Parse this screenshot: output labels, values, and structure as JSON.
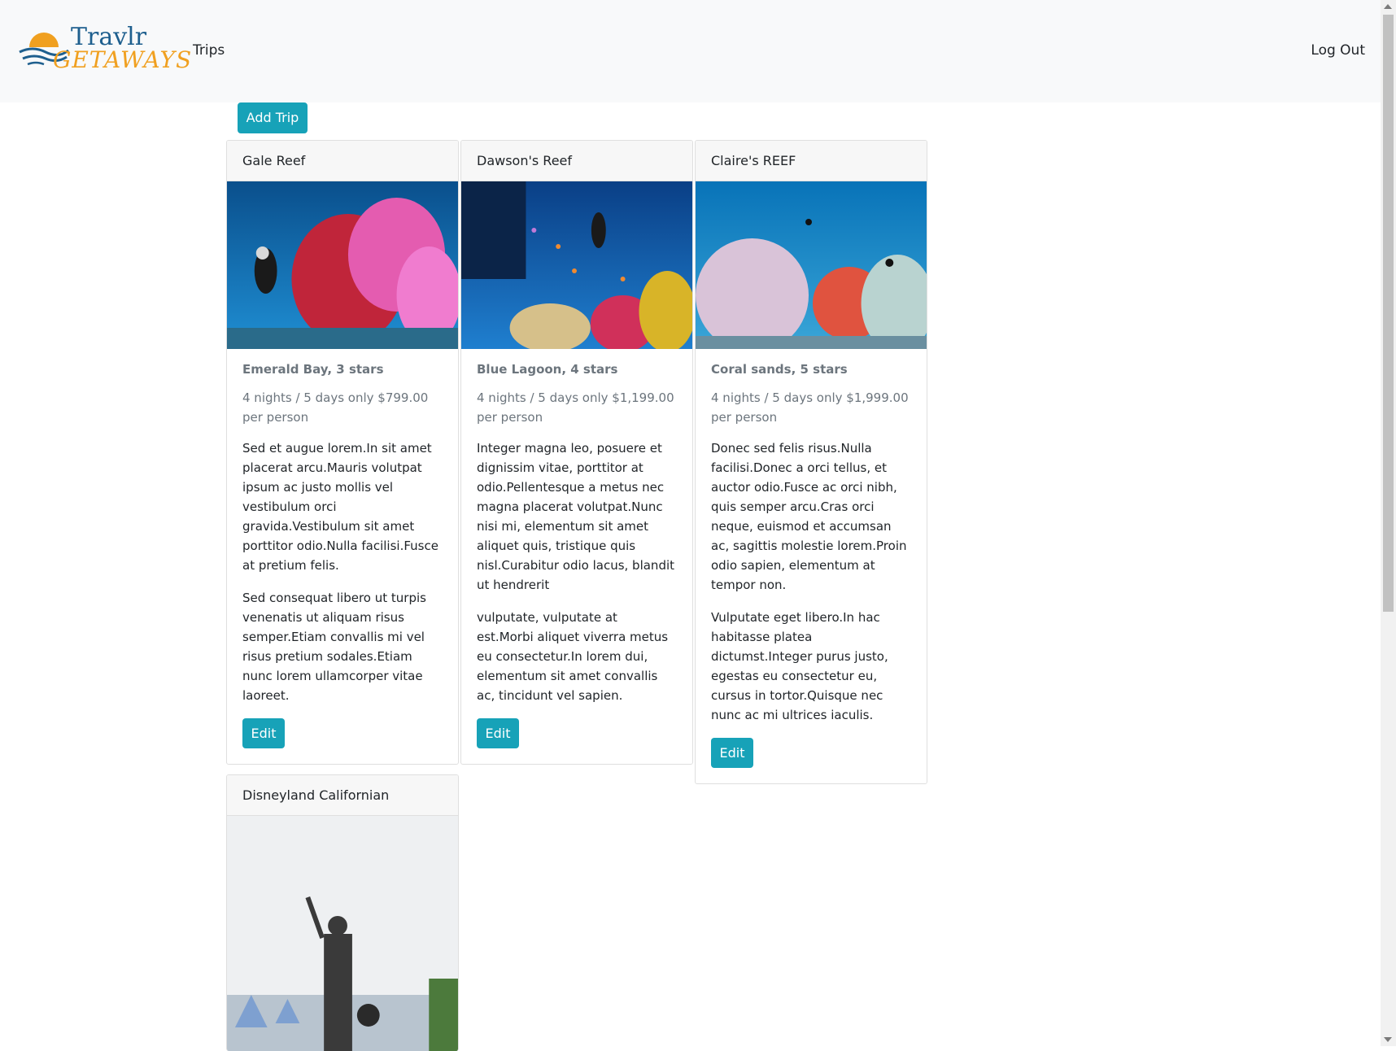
{
  "nav": {
    "logo_line1": "Travlr",
    "logo_line2": "GETAWAYS",
    "trips": "Trips",
    "logout": "Log Out"
  },
  "actions": {
    "add_trip": "Add Trip"
  },
  "cards": [
    {
      "title": "Gale Reef",
      "subtitle": "Emerald Bay, 3 stars",
      "price": "4 nights / 5 days only $799.00 per person",
      "p1": "Sed et augue lorem.In sit amet placerat arcu.Mauris volutpat ipsum ac justo mollis vel vestibulum orci gravida.Vestibulum sit amet porttitor odio.Nulla facilisi.Fusce at pretium felis.",
      "p2": "Sed consequat libero ut turpis venenatis ut aliquam risus semper.Etiam convallis mi vel risus pretium sodales.Etiam nunc lorem ullamcorper vitae laoreet.",
      "edit": "Edit"
    },
    {
      "title": "Dawson's Reef",
      "subtitle": "Blue Lagoon, 4 stars",
      "price": "4 nights / 5 days only $1,199.00 per person",
      "p1": "Integer magna leo, posuere et dignissim vitae, porttitor at odio.Pellentesque a metus nec magna placerat volutpat.Nunc nisi mi, elementum sit amet aliquet quis, tristique quis nisl.Curabitur odio lacus, blandit ut hendrerit",
      "p2": "vulputate, vulputate at est.Morbi aliquet viverra metus eu consectetur.In lorem dui, elementum sit amet convallis ac, tincidunt vel sapien.",
      "edit": "Edit"
    },
    {
      "title": "Claire's REEF",
      "subtitle": "Coral sands, 5 stars",
      "price": "4 nights / 5 days only $1,999.00 per person",
      "p1": "Donec sed felis risus.Nulla facilisi.Donec a orci tellus, et auctor odio.Fusce ac orci nibh, quis semper arcu.Cras orci neque, euismod et accumsan ac, sagittis molestie lorem.Proin odio sapien, elementum at tempor non.",
      "p2": "Vulputate eget libero.In hac habitasse platea dictumst.Integer purus justo, egestas eu consectetur eu, cursus in tortor.Quisque nec nunc ac mi ultrices iaculis.",
      "edit": "Edit"
    },
    {
      "title": "Disneyland Californian"
    }
  ]
}
